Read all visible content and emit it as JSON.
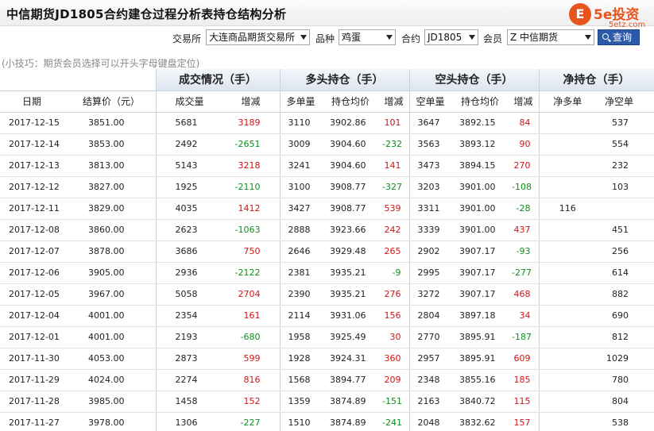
{
  "title": "中信期货JD1805合约建仓过程分析表持仓结构分析",
  "logo": {
    "mark": "E",
    "name": "5e投资",
    "sub": "5etz.com"
  },
  "filters": {
    "exchange_label": "交易所",
    "exchange_value": "大连商品期货交易所",
    "variety_label": "品种",
    "variety_value": "鸡蛋",
    "contract_label": "合约",
    "contract_value": "JD1805",
    "member_label": "会员",
    "member_value": "Z 中信期货",
    "query_label": "查询"
  },
  "tip": "(小技巧：期货会员选择可以开头字母键盘定位)",
  "table": {
    "groups": [
      "成交情况（手）",
      "多头持仓（手）",
      "空头持仓（手）",
      "净持仓（手）"
    ],
    "columns": [
      "日期",
      "结算价（元）",
      "成交量",
      "增减",
      "多单量",
      "持仓均价",
      "增减",
      "空单量",
      "持仓均价",
      "增减",
      "净多单",
      "净空单"
    ],
    "rows": [
      [
        "2017-12-15",
        "3851.00",
        "5681",
        "3189",
        "3110",
        "3902.86",
        "101",
        "3647",
        "3892.15",
        "84",
        "",
        "537"
      ],
      [
        "2017-12-14",
        "3853.00",
        "2492",
        "-2651",
        "3009",
        "3904.60",
        "-232",
        "3563",
        "3893.12",
        "90",
        "",
        "554"
      ],
      [
        "2017-12-13",
        "3813.00",
        "5143",
        "3218",
        "3241",
        "3904.60",
        "141",
        "3473",
        "3894.15",
        "270",
        "",
        "232"
      ],
      [
        "2017-12-12",
        "3827.00",
        "1925",
        "-2110",
        "3100",
        "3908.77",
        "-327",
        "3203",
        "3901.00",
        "-108",
        "",
        "103"
      ],
      [
        "2017-12-11",
        "3829.00",
        "4035",
        "1412",
        "3427",
        "3908.77",
        "539",
        "3311",
        "3901.00",
        "-28",
        "116",
        ""
      ],
      [
        "2017-12-08",
        "3860.00",
        "2623",
        "-1063",
        "2888",
        "3923.66",
        "242",
        "3339",
        "3901.00",
        "437",
        "",
        "451"
      ],
      [
        "2017-12-07",
        "3878.00",
        "3686",
        "750",
        "2646",
        "3929.48",
        "265",
        "2902",
        "3907.17",
        "-93",
        "",
        "256"
      ],
      [
        "2017-12-06",
        "3905.00",
        "2936",
        "-2122",
        "2381",
        "3935.21",
        "-9",
        "2995",
        "3907.17",
        "-277",
        "",
        "614"
      ],
      [
        "2017-12-05",
        "3967.00",
        "5058",
        "2704",
        "2390",
        "3935.21",
        "276",
        "3272",
        "3907.17",
        "468",
        "",
        "882"
      ],
      [
        "2017-12-04",
        "4001.00",
        "2354",
        "161",
        "2114",
        "3931.06",
        "156",
        "2804",
        "3897.18",
        "34",
        "",
        "690"
      ],
      [
        "2017-12-01",
        "4001.00",
        "2193",
        "-680",
        "1958",
        "3925.49",
        "30",
        "2770",
        "3895.91",
        "-187",
        "",
        "812"
      ],
      [
        "2017-11-30",
        "4053.00",
        "2873",
        "599",
        "1928",
        "3924.31",
        "360",
        "2957",
        "3895.91",
        "609",
        "",
        "1029"
      ],
      [
        "2017-11-29",
        "4024.00",
        "2274",
        "816",
        "1568",
        "3894.77",
        "209",
        "2348",
        "3855.16",
        "185",
        "",
        "780"
      ],
      [
        "2017-11-28",
        "3985.00",
        "1458",
        "152",
        "1359",
        "3874.89",
        "-151",
        "2163",
        "3840.72",
        "115",
        "",
        "804"
      ],
      [
        "2017-11-27",
        "3978.00",
        "1306",
        "-227",
        "1510",
        "3874.89",
        "-241",
        "2048",
        "3832.62",
        "157",
        "",
        "538"
      ]
    ]
  },
  "colors": {
    "up": "#d41313",
    "down": "#0e8e1e",
    "header_blue": "#2c5aa8"
  }
}
